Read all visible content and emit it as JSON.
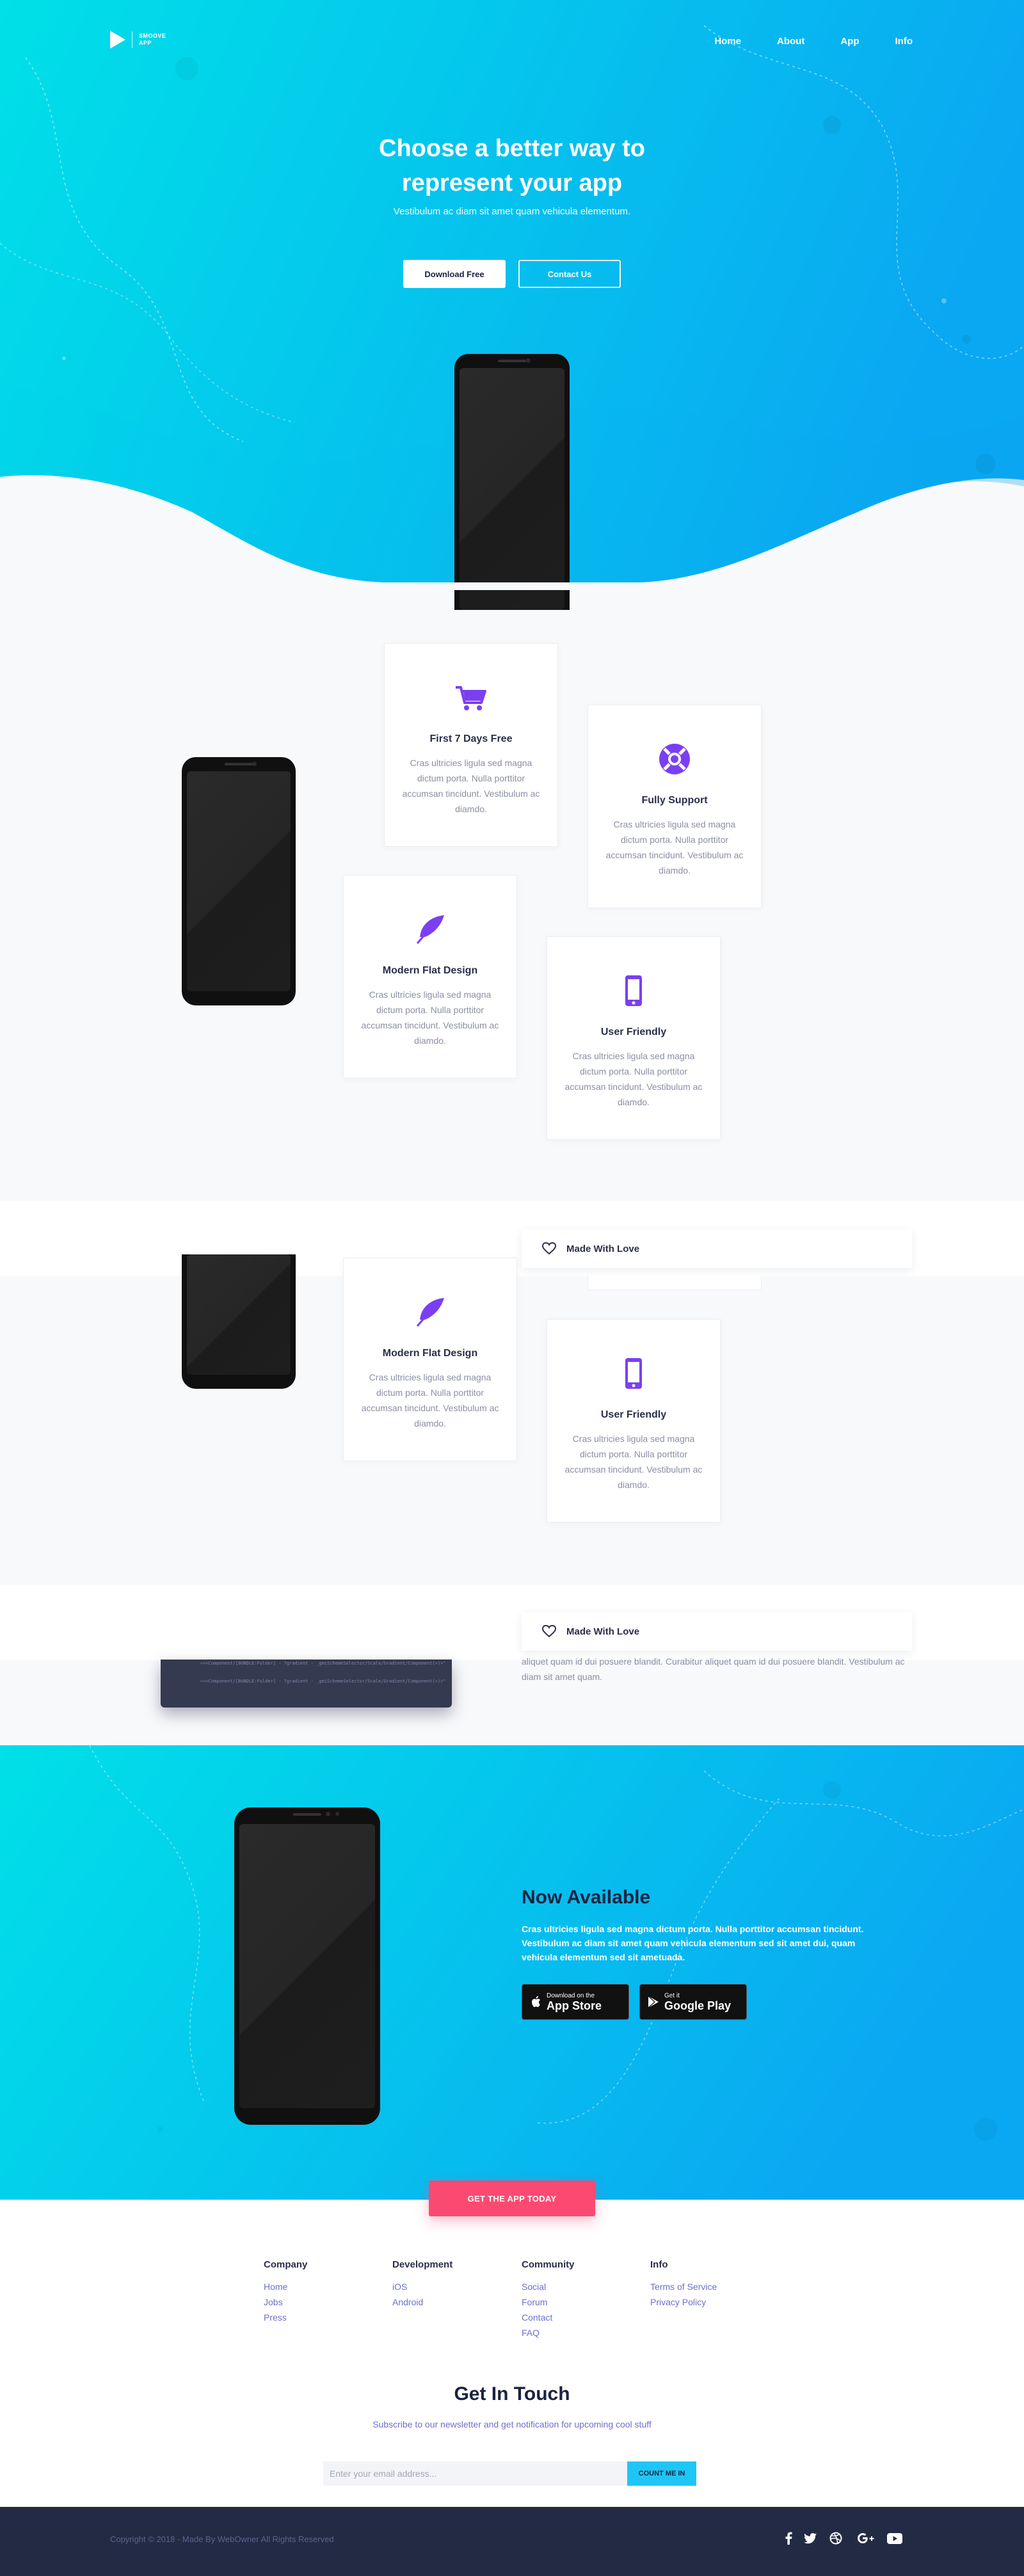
{
  "brand": {
    "logo_line1": "SMOOVE",
    "logo_line2": "APP"
  },
  "nav": {
    "items": [
      "Home",
      "About",
      "App",
      "Info"
    ]
  },
  "hero": {
    "title_line1": "Choose a better way to",
    "title_line2": "represent your app",
    "subtitle": "Vestibulum ac diam sit amet quam vehicula elementum.",
    "primary_button": "Download Free",
    "secondary_button": "Contact Us"
  },
  "features": {
    "cards": [
      {
        "icon": "cart-icon",
        "title": "First 7 Days Free",
        "text": "Cras ultricies ligula sed magna dictum porta. Nulla porttitor accumsan tincidunt. Vestibulum ac diamdo."
      },
      {
        "icon": "lifebuoy-icon",
        "title": "Fully Support",
        "text": "Cras ultricies ligula sed magna dictum porta. Nulla porttitor accumsan tincidunt. Vestibulum ac diamdo."
      },
      {
        "icon": "feather-icon",
        "title": "Modern Flat Design",
        "text": "Cras ultricies ligula sed magna dictum porta. Nulla porttitor accumsan tincidunt. Vestibulum ac diamdo."
      },
      {
        "icon": "mobile-icon",
        "title": "User Friendly",
        "text": "Cras ultricies ligula sed magna dictum porta. Nulla porttitor accumsan tincidunt. Vestibulum ac diamdo."
      }
    ],
    "made_with_love": "Made With Love"
  },
  "code_section": {
    "lines": [
      "<<<Component/[BUNDLE:Folder] - ?gradient - _gmiSchemeSelector/Scale/Gradient/Component(>)>\"",
      "<<<Component/[BUNDLE:Folder] - ?gradient - _gmiSchemeSelector/Scale/Gradient/Component(>)>\""
    ],
    "text": "aliquet quam id dui posuere blandit. Curabitur aliquet quam id dui posuere blandit. Vestibulum ac diam sit amet quam."
  },
  "available": {
    "title": "Now Available",
    "text": "Cras ultricies ligula sed magna dictum porta. Nulla porttitor accumsan tincidunt. Vestibulum ac diam sit amet quam vehicula elementum sed sit amet dui, quam vehicula elementum sed sit ametuada.",
    "appstore_small": "Download on the",
    "appstore_big": "App Store",
    "googleplay_small": "Get it",
    "googleplay_big": "Google Play",
    "cta": "GET THE APP TODAY"
  },
  "footer": {
    "columns": [
      {
        "title": "Company",
        "links": [
          "Home",
          "Jobs",
          "Press"
        ]
      },
      {
        "title": "Development",
        "links": [
          "iOS",
          "Android"
        ]
      },
      {
        "title": "Community",
        "links": [
          "Social",
          "Forum",
          "Contact",
          "FAQ"
        ]
      },
      {
        "title": "Info",
        "links": [
          "Terms of Service",
          "Privacy Policy"
        ]
      }
    ],
    "newsletter_title": "Get In Touch",
    "newsletter_sub": "Subscribe to our newsletter and get notification for upcoming cool stuff",
    "email_placeholder": "Enter your email address...",
    "subscribe_button": "COUNT ME IN",
    "copyright": "Copyright © 2018 - Made By WebOwner All Rights Reserved",
    "social": [
      "facebook-icon",
      "twitter-icon",
      "dribbble-icon",
      "google-plus-icon",
      "youtube-icon"
    ]
  },
  "colors": {
    "hero_start": "#00e0e8",
    "hero_end": "#0aa8f2",
    "accent_purple": "#7b3ff2",
    "cta_pink": "#fb4a72",
    "footer_dark": "#232a44"
  }
}
